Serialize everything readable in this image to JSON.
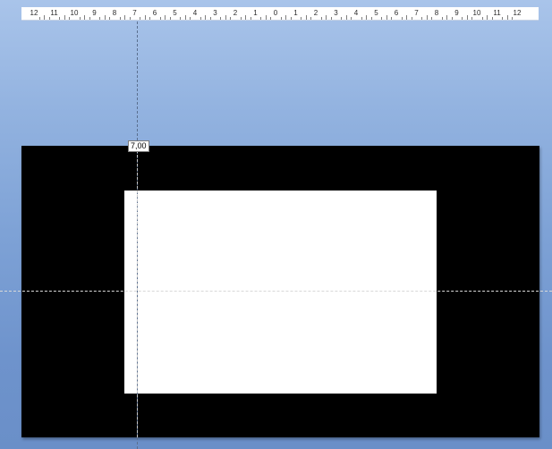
{
  "ruler": {
    "labels": [
      "12",
      "11",
      "10",
      "9",
      "8",
      "7",
      "6",
      "5",
      "4",
      "3",
      "2",
      "1",
      "0",
      "1",
      "2",
      "3",
      "4",
      "5",
      "6",
      "7",
      "8",
      "9",
      "10",
      "11",
      "12"
    ]
  },
  "guide": {
    "position_label": "7,00"
  },
  "colors": {
    "background_top": "#a9c4ea",
    "background_bottom": "#6a8fc8",
    "slide": "#000000",
    "shape": "#ffffff"
  }
}
